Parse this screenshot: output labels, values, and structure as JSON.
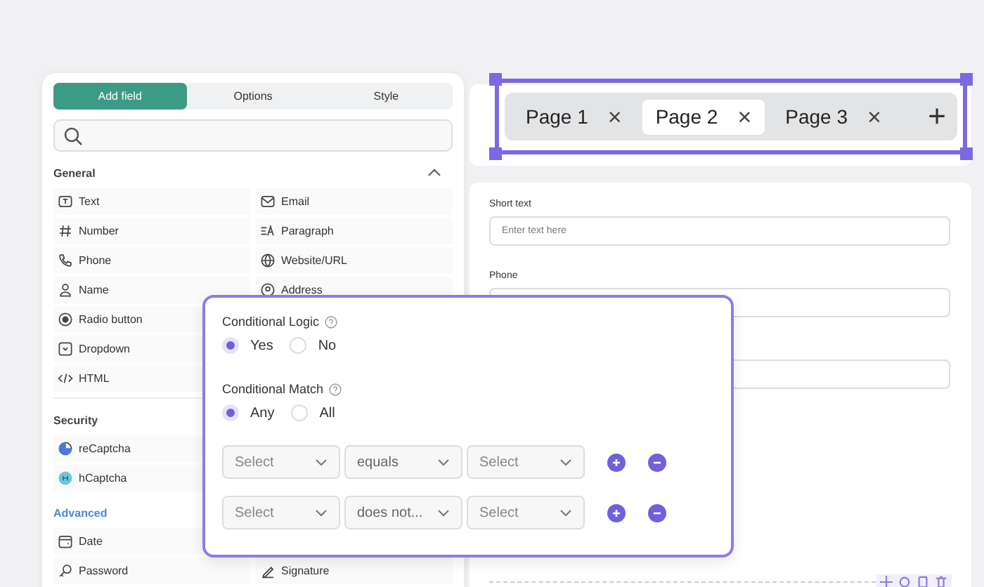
{
  "panel_tabs": [
    {
      "label": "Add field",
      "selected": true
    },
    {
      "label": "Options",
      "selected": false
    },
    {
      "label": "Style",
      "selected": false
    }
  ],
  "search": {
    "kind": "search"
  },
  "sections": [
    {
      "title": "General",
      "accent": false,
      "expanded": true,
      "rows": [
        [
          {
            "label": "Text"
          },
          {
            "label": "Email"
          }
        ],
        [
          {
            "label": "Number"
          },
          {
            "label": "Paragraph"
          }
        ],
        [
          {
            "label": "Phone"
          },
          {
            "label": "Website/URL"
          }
        ],
        [
          {
            "label": "Name"
          },
          {
            "label": "Address"
          }
        ],
        [
          {
            "label": "Radio button"
          }
        ],
        [
          {
            "label": "Dropdown"
          }
        ],
        [
          {
            "label": "HTML"
          }
        ]
      ]
    },
    {
      "title": "Security",
      "accent": false,
      "rows": [
        [
          {
            "label": "reCaptcha"
          }
        ],
        [
          {
            "label": "hCaptcha"
          }
        ]
      ]
    },
    {
      "title": "Advanced",
      "accent": true,
      "rows": [
        [
          {
            "label": "Date"
          }
        ],
        [
          {
            "label": "Password"
          },
          {
            "label": "Signature"
          }
        ]
      ]
    }
  ],
  "page_tabs": [
    {
      "label": "Page 1",
      "selected": false
    },
    {
      "label": "Page 2",
      "selected": true
    },
    {
      "label": "Page 3",
      "selected": false
    }
  ],
  "page_tab_close": "×",
  "page_add": "+",
  "form_fields": [
    {
      "kind": "input",
      "label": "Short text",
      "placeholder": "Enter text here"
    },
    {
      "kind": "input",
      "label": "Phone"
    },
    {
      "kind": "input"
    }
  ],
  "conditional": {
    "logic_label": "Conditional Logic",
    "logic_options": [
      {
        "label": "Yes",
        "selected": true
      },
      {
        "label": "No",
        "selected": false
      }
    ],
    "match_label": "Conditional Match",
    "match_options": [
      {
        "label": "Any",
        "selected": true
      },
      {
        "label": "All",
        "selected": false
      }
    ],
    "rules": [
      {
        "field": "Select",
        "operator": "equals",
        "value": "Select"
      },
      {
        "field": "Select",
        "operator": "does not...",
        "value": "Select"
      }
    ]
  }
}
